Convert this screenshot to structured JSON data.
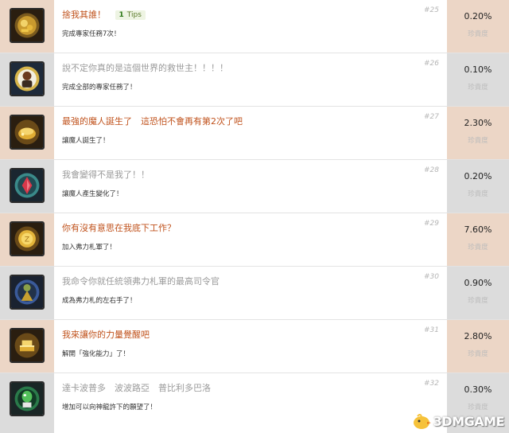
{
  "achievements": [
    {
      "num": "#25",
      "title": "捨我其誰！",
      "tips_count": "1",
      "tips_label": "Tips",
      "desc": "完成專家任務7次！",
      "percent": "0.20%",
      "rarity": "珍貴度",
      "tier": "gold",
      "icon": "treasure-icon"
    },
    {
      "num": "#26",
      "title": "說不定你真的是這個世界的救世主！！！！",
      "desc": "完成全部的專家任務了！",
      "percent": "0.10%",
      "rarity": "珍貴度",
      "tier": "silver",
      "icon": "savior-portrait-icon"
    },
    {
      "num": "#27",
      "title": "最強的魔人誕生了　這恐怕不會再有第2次了吧",
      "desc": "讓魔人誕生了！",
      "percent": "2.30%",
      "rarity": "珍貴度",
      "tier": "gold",
      "icon": "gold-coins-icon"
    },
    {
      "num": "#28",
      "title": "我會變得不是我了！！",
      "desc": "讓魔人產生變化了！",
      "percent": "0.20%",
      "rarity": "珍貴度",
      "tier": "silver",
      "icon": "red-crystal-icon"
    },
    {
      "num": "#29",
      "title": "你有沒有意思在我底下工作？",
      "desc": "加入弗力札軍了！",
      "percent": "7.60%",
      "rarity": "珍貴度",
      "tier": "gold",
      "icon": "gold-coin-icon"
    },
    {
      "num": "#30",
      "title": "我命令你就任統領弗力札軍的最高司令官",
      "desc": "成為弗力札的左右手了！",
      "percent": "0.90%",
      "rarity": "珍貴度",
      "tier": "silver",
      "icon": "commander-icon"
    },
    {
      "num": "#31",
      "title": "我來讓你的力量覺醒吧",
      "desc": "解開「強化能力」了！",
      "percent": "2.80%",
      "rarity": "珍貴度",
      "tier": "gold",
      "icon": "gold-bars-icon"
    },
    {
      "num": "#32",
      "title": "達卡波普多　波波路亞　普比利多巴洛",
      "desc": "增加可以向神龍許下的願望了！",
      "percent": "0.30%",
      "rarity": "珍貴度",
      "tier": "silver",
      "icon": "namekian-icon"
    }
  ],
  "watermark": {
    "text": "3DMGAME"
  }
}
